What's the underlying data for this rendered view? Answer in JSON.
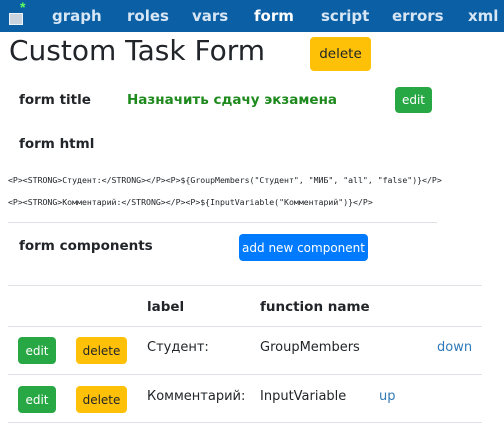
{
  "nav": {
    "items": [
      {
        "label": "graph"
      },
      {
        "label": "roles"
      },
      {
        "label": "vars"
      },
      {
        "label": "form"
      },
      {
        "label": "script"
      },
      {
        "label": "errors"
      },
      {
        "label": "xml"
      }
    ],
    "active": "form"
  },
  "page": {
    "title": "Custom Task Form",
    "delete_label": "delete"
  },
  "form_title": {
    "label": "form title",
    "value": "Назначить сдачу экзамена",
    "edit_label": "edit"
  },
  "form_html": {
    "label": "form html",
    "lines": [
      "<P><STRONG>Студент:</STRONG></P><P>${GroupMembers(\"Студент\", \"МИБ\", \"all\", \"false\")}</P>",
      "<P><STRONG>Комментарий:</STRONG></P><P>${InputVariable(\"Комментарий\")}</P>"
    ]
  },
  "form_components": {
    "label": "form components",
    "add_label": "add new component",
    "columns": {
      "label": "label",
      "function": "function name"
    },
    "rows": [
      {
        "edit": "edit",
        "delete": "delete",
        "label": "Студент:",
        "function": "GroupMembers",
        "move": "down"
      },
      {
        "edit": "edit",
        "delete": "delete",
        "label": "Комментарий:",
        "function": "InputVariable",
        "move": "up"
      }
    ]
  },
  "colors": {
    "nav_bg": "#0b5fa5",
    "warning": "#ffc107",
    "success": "#28a745",
    "primary": "#007bff",
    "title_green": "#1e8a1e",
    "link": "#2f79b9"
  }
}
